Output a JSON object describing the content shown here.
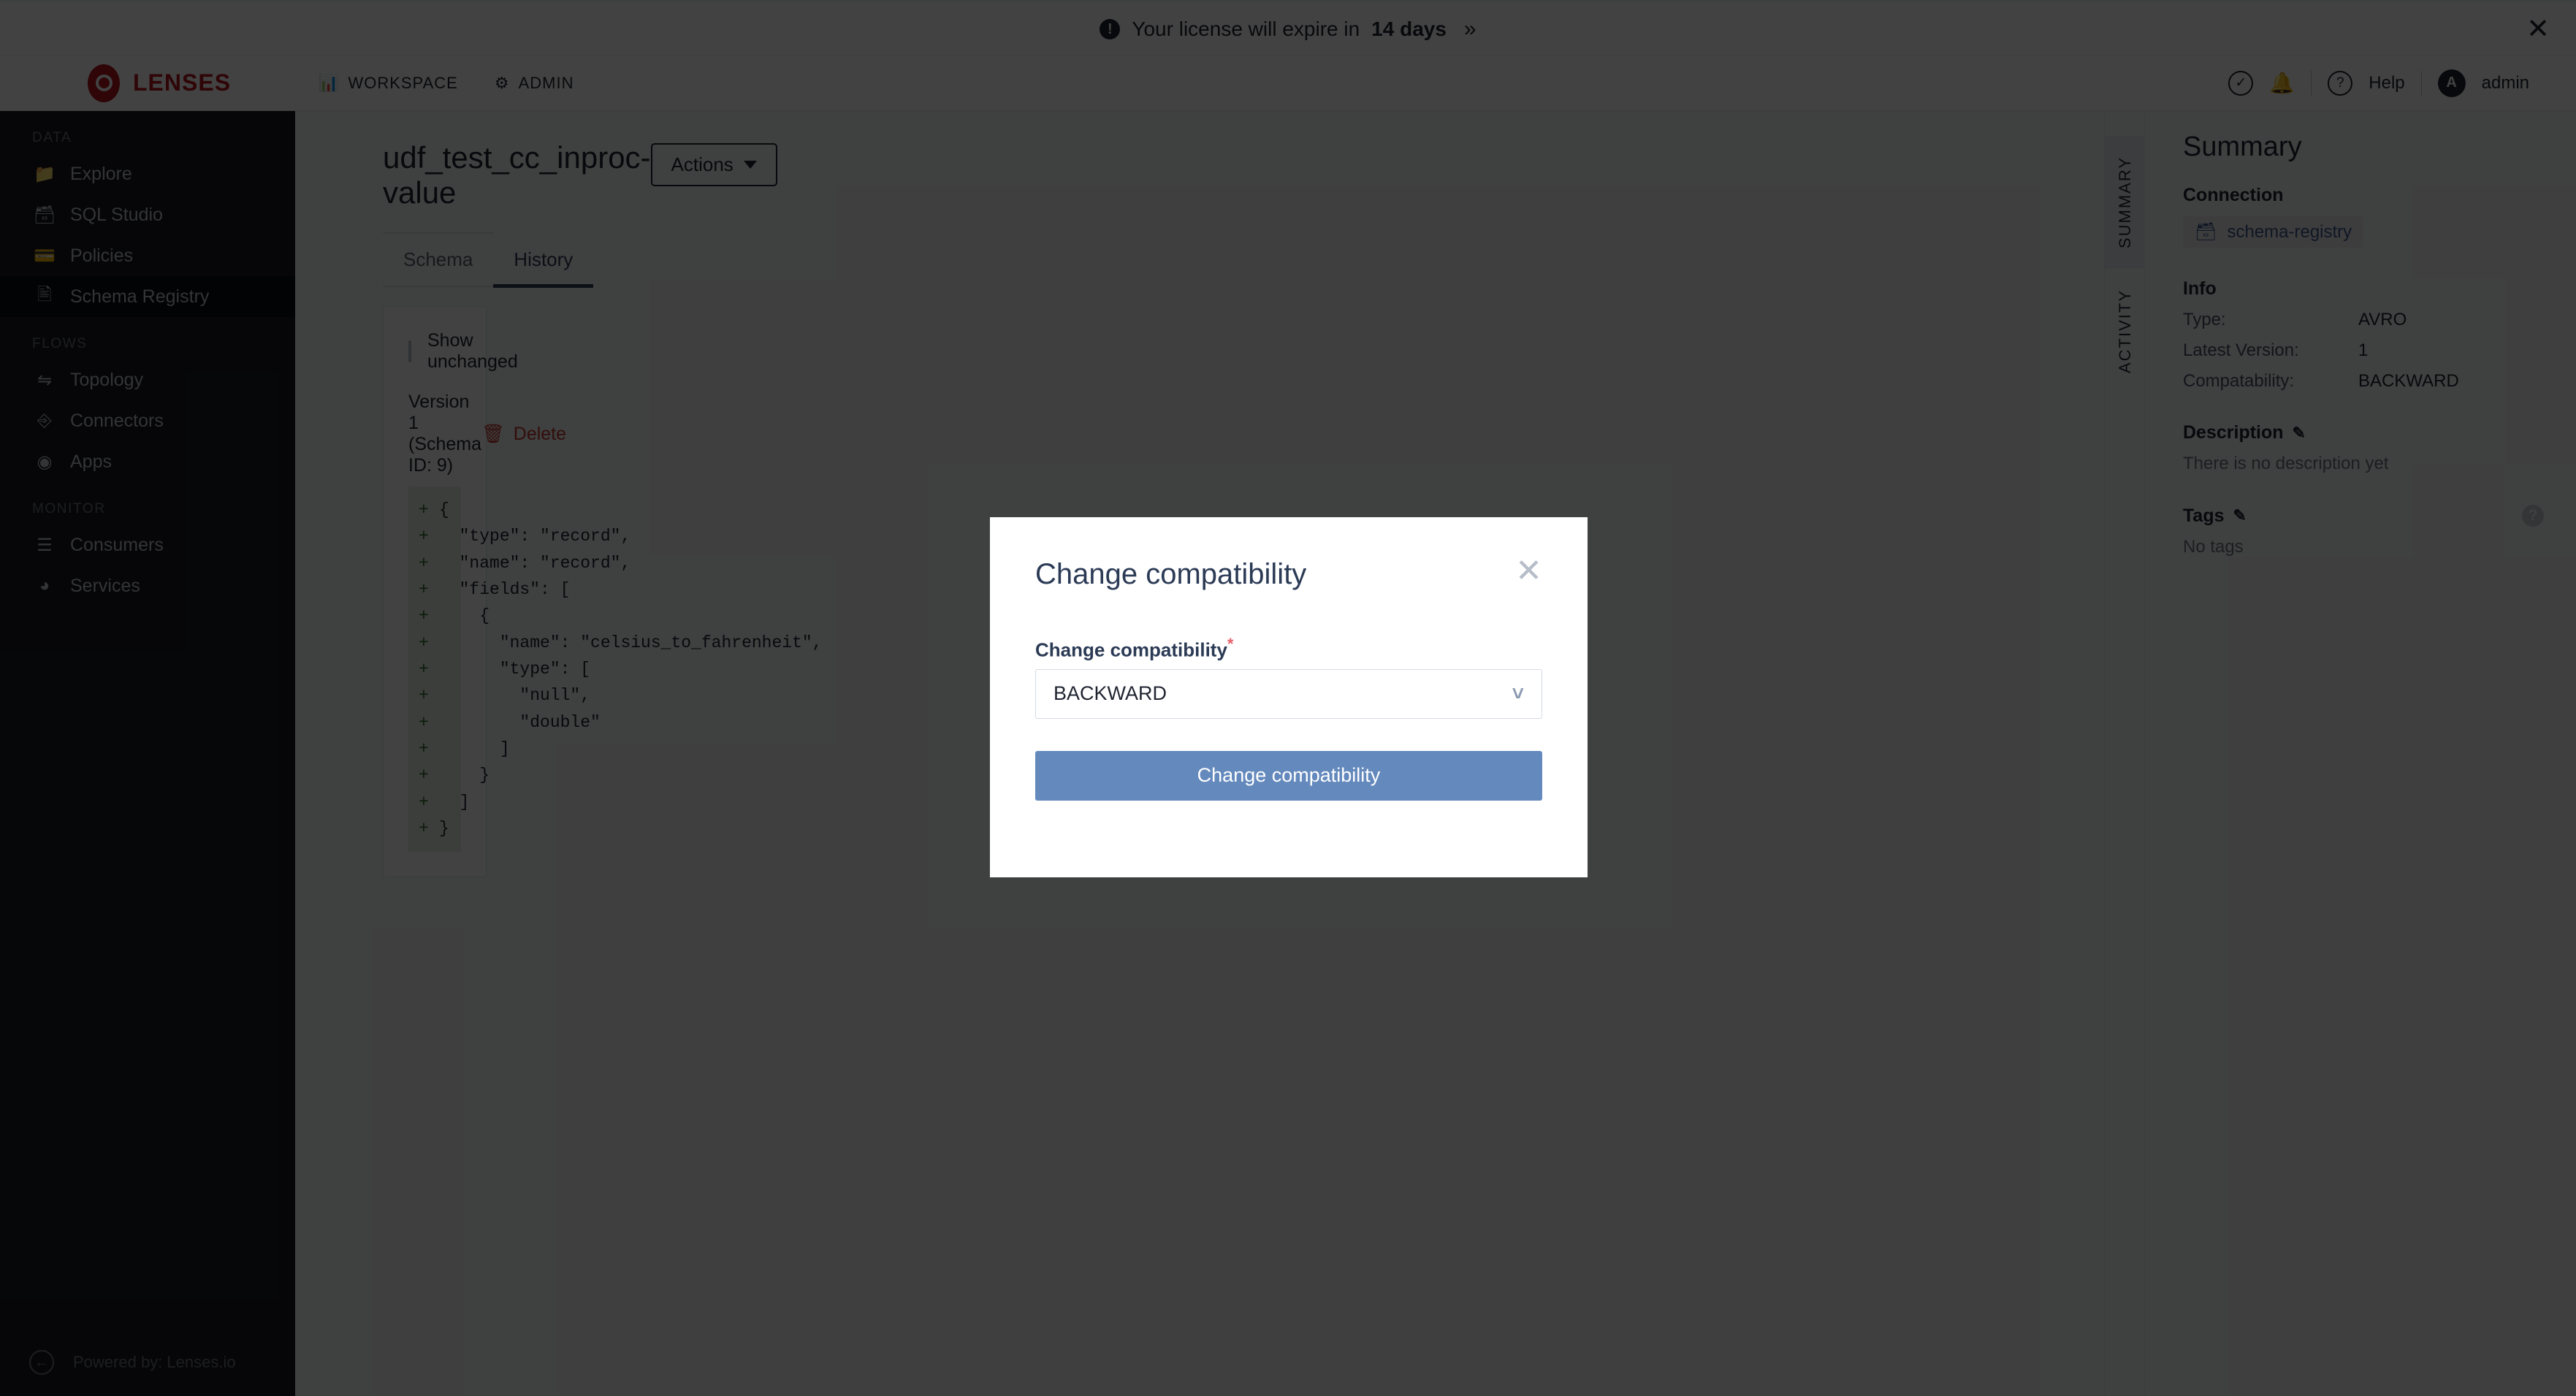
{
  "license_banner": {
    "icon": "exclamation-circle-icon",
    "text_prefix": "Your license will expire in",
    "text_strong": "14 days",
    "expand_icon": "double-chevron-right-icon",
    "close_icon": "close-icon"
  },
  "topnav": {
    "brand": "LENSES",
    "links": [
      {
        "label": "WORKSPACE",
        "icon": "bar-chart-icon"
      },
      {
        "label": "ADMIN",
        "icon": "gear-icon"
      }
    ],
    "right": {
      "check_icon": "check-circle-icon",
      "bell_icon": "bell-icon",
      "help_icon": "question-circle-icon",
      "help_label": "Help",
      "avatar_initial": "A",
      "user_label": "admin"
    }
  },
  "sidebar": {
    "groups": [
      {
        "label": "DATA",
        "items": [
          {
            "label": "Explore",
            "icon": "folder-icon",
            "active": false
          },
          {
            "label": "SQL Studio",
            "icon": "database-icon",
            "active": false
          },
          {
            "label": "Policies",
            "icon": "id-card-icon",
            "active": false
          },
          {
            "label": "Schema Registry",
            "icon": "document-icon",
            "active": true
          }
        ]
      },
      {
        "label": "FLOWS",
        "items": [
          {
            "label": "Topology",
            "icon": "share-nodes-icon",
            "active": false
          },
          {
            "label": "Connectors",
            "icon": "plug-icon",
            "active": false
          },
          {
            "label": "Apps",
            "icon": "apps-icon",
            "active": false
          }
        ]
      },
      {
        "label": "MONITOR",
        "items": [
          {
            "label": "Consumers",
            "icon": "sliders-icon",
            "active": false
          },
          {
            "label": "Services",
            "icon": "gauge-icon",
            "active": false
          }
        ]
      }
    ],
    "footer": {
      "collapse_icon": "collapse-left-icon",
      "powered_by": "Powered by: Lenses.io"
    }
  },
  "main": {
    "page_title": "udf_test_cc_inproc-value",
    "actions_button": "Actions",
    "tabs": [
      {
        "label": "Schema",
        "active": false
      },
      {
        "label": "History",
        "active": true
      }
    ],
    "show_unchanged_label": "Show unchanged",
    "show_unchanged_checked": false,
    "version_label": "Version 1 (Schema ID: 9)",
    "delete_label": "Delete",
    "delete_icon": "trash-icon",
    "diff_marker": "+",
    "diff_lines": [
      "{",
      "  \"type\": \"record\",",
      "  \"name\": \"record\",",
      "  \"fields\": [",
      "    {",
      "      \"name\": \"celsius_to_fahrenheit\",",
      "      \"type\": [",
      "        \"null\",",
      "        \"double\"",
      "      ]",
      "    }",
      "  ]",
      "}"
    ]
  },
  "vtabs": [
    {
      "label": "SUMMARY",
      "active": true
    },
    {
      "label": "ACTIVITY",
      "active": false
    }
  ],
  "summary": {
    "title": "Summary",
    "connection_head": "Connection",
    "connection_value": "schema-registry",
    "connection_icon": "database-icon",
    "info_head": "Info",
    "info_rows": [
      {
        "key": "Type:",
        "value": "AVRO"
      },
      {
        "key": "Latest Version:",
        "value": "1"
      },
      {
        "key": "Compatability:",
        "value": "BACKWARD"
      }
    ],
    "description_head": "Description",
    "description_edit_icon": "edit-pencil-icon",
    "description_empty": "There is no description yet",
    "tags_head": "Tags",
    "tags_edit_icon": "edit-pencil-icon",
    "tags_help_icon": "question-mark-icon",
    "tags_empty": "No tags"
  },
  "modal": {
    "title": "Change compatibility",
    "close_icon": "close-icon",
    "field_label": "Change compatibility",
    "required_marker": "*",
    "select_value": "BACKWARD",
    "select_caret_icon": "chevron-down-icon",
    "submit_label": "Change compatibility"
  },
  "colors": {
    "brand_red": "#b5151c",
    "accent_blue": "#6489bd",
    "tab_active": "#2b3a55",
    "danger": "#c0392b",
    "diff_add_bg": "#e6f0e3",
    "required_star": "#e8606a"
  }
}
